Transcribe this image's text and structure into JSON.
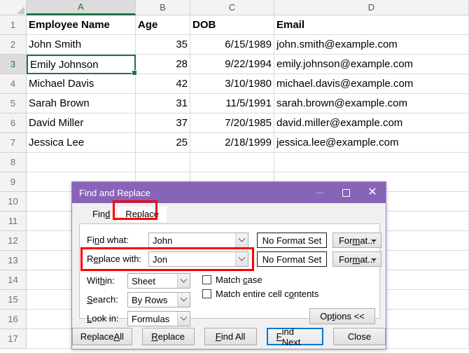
{
  "sheet": {
    "columns": [
      "A",
      "B",
      "C",
      "D"
    ],
    "selected_column": "A",
    "selected_row": "3",
    "selected_cell": "A3",
    "row_numbers": [
      "1",
      "2",
      "3",
      "4",
      "5",
      "6",
      "7",
      "8",
      "9",
      "10",
      "11",
      "12",
      "13",
      "14",
      "15",
      "16",
      "17"
    ],
    "headers": {
      "a": "Employee Name",
      "b": "Age",
      "c": "DOB",
      "d": "Email"
    },
    "rows": [
      {
        "name": "John Smith",
        "age": "35",
        "dob": "6/15/1989",
        "email": "john.smith@example.com"
      },
      {
        "name": "Emily Johnson",
        "age": "28",
        "dob": "9/22/1994",
        "email": "emily.johnson@example.com"
      },
      {
        "name": "Michael Davis",
        "age": "42",
        "dob": "3/10/1980",
        "email": "michael.davis@example.com"
      },
      {
        "name": "Sarah Brown",
        "age": "31",
        "dob": "11/5/1991",
        "email": "sarah.brown@example.com"
      },
      {
        "name": "David Miller",
        "age": "37",
        "dob": "7/20/1985",
        "email": "david.miller@example.com"
      },
      {
        "name": "Jessica Lee",
        "age": "25",
        "dob": "2/18/1999",
        "email": "jessica.lee@example.com"
      }
    ],
    "accent_color": "#217346"
  },
  "dialog": {
    "title": "Find and Replace",
    "titlebar_color": "#8764b8",
    "highlight_color": "#ff0000",
    "focus_color": "#0078d7",
    "window_buttons": {
      "minimize": "minimize-icon",
      "maximize": "maximize-icon",
      "close": "close-icon"
    },
    "tabs": [
      {
        "label": "Find",
        "active": false
      },
      {
        "label": "Replace",
        "active": true
      }
    ],
    "fields": {
      "find_label": "Find what:",
      "find_value": "John",
      "replace_label": "Replace with:",
      "replace_value": "Jon",
      "no_format_set": "No Format Set",
      "format_button": "Format..."
    },
    "options": {
      "within_label": "Within:",
      "within_value": "Sheet",
      "search_label": "Search:",
      "search_value": "By Rows",
      "lookin_label": "Look in:",
      "lookin_value": "Formulas",
      "match_case_label": "Match case",
      "match_case_checked": false,
      "match_entire_label": "Match entire cell contents",
      "match_entire_checked": false,
      "options_button": "Options <<"
    },
    "footer_buttons": [
      {
        "label": "Replace All",
        "default": false
      },
      {
        "label": "Replace",
        "default": false
      },
      {
        "label": "Find All",
        "default": false
      },
      {
        "label": "Find Next",
        "default": true
      },
      {
        "label": "Close",
        "default": false
      }
    ]
  }
}
